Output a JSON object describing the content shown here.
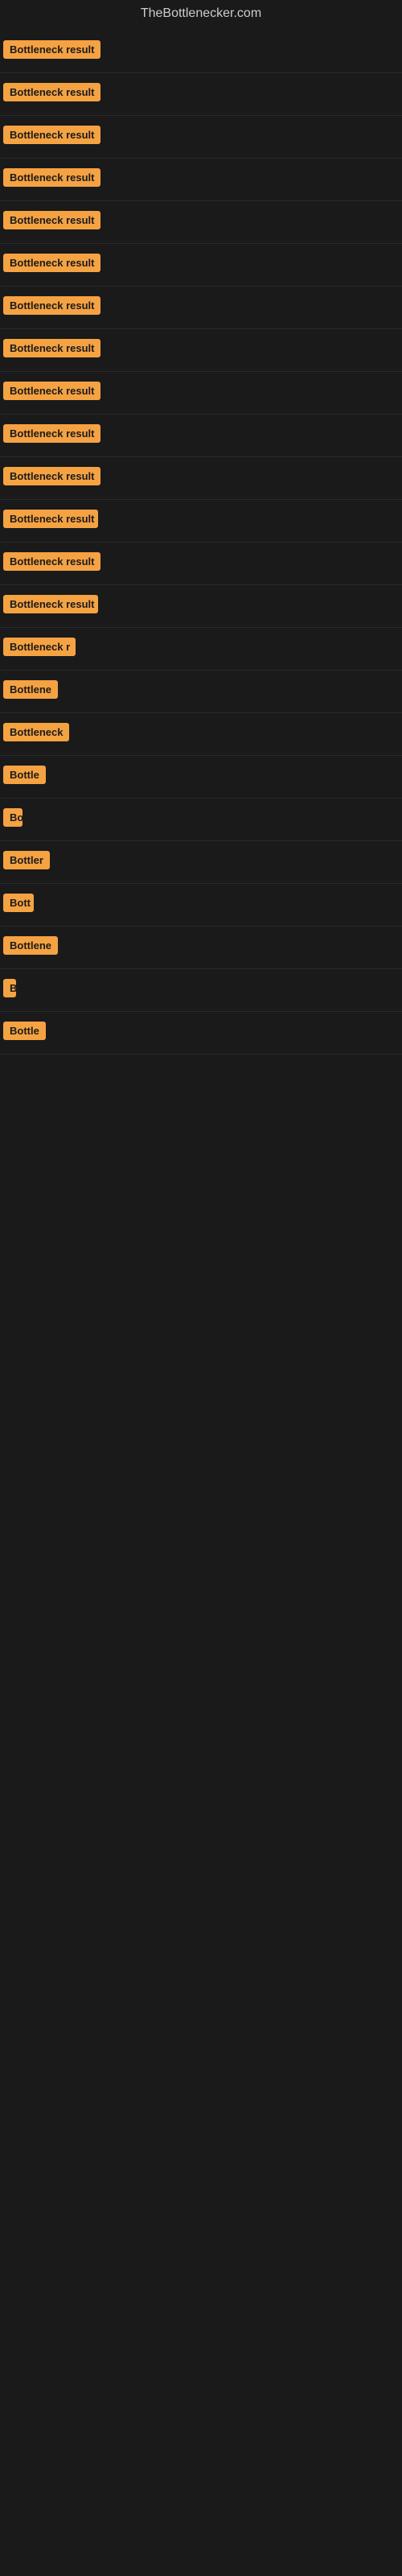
{
  "site_title": "TheBottlenecker.com",
  "badges": [
    {
      "label": "Bottleneck result",
      "width": 130
    },
    {
      "label": "Bottleneck result",
      "width": 130
    },
    {
      "label": "Bottleneck result",
      "width": 130
    },
    {
      "label": "Bottleneck result",
      "width": 130
    },
    {
      "label": "Bottleneck result",
      "width": 130
    },
    {
      "label": "Bottleneck result",
      "width": 130
    },
    {
      "label": "Bottleneck result",
      "width": 130
    },
    {
      "label": "Bottleneck result",
      "width": 130
    },
    {
      "label": "Bottleneck result",
      "width": 130
    },
    {
      "label": "Bottleneck result",
      "width": 130
    },
    {
      "label": "Bottleneck result",
      "width": 130
    },
    {
      "label": "Bottleneck result",
      "width": 118
    },
    {
      "label": "Bottleneck result",
      "width": 130
    },
    {
      "label": "Bottleneck result",
      "width": 118
    },
    {
      "label": "Bottleneck r",
      "width": 90
    },
    {
      "label": "Bottlene",
      "width": 72
    },
    {
      "label": "Bottleneck",
      "width": 82
    },
    {
      "label": "Bottle",
      "width": 55
    },
    {
      "label": "Bo",
      "width": 24
    },
    {
      "label": "Bottler",
      "width": 58
    },
    {
      "label": "Bott",
      "width": 38
    },
    {
      "label": "Bottlene",
      "width": 72
    },
    {
      "label": "B",
      "width": 16
    },
    {
      "label": "Bottle",
      "width": 55
    }
  ]
}
